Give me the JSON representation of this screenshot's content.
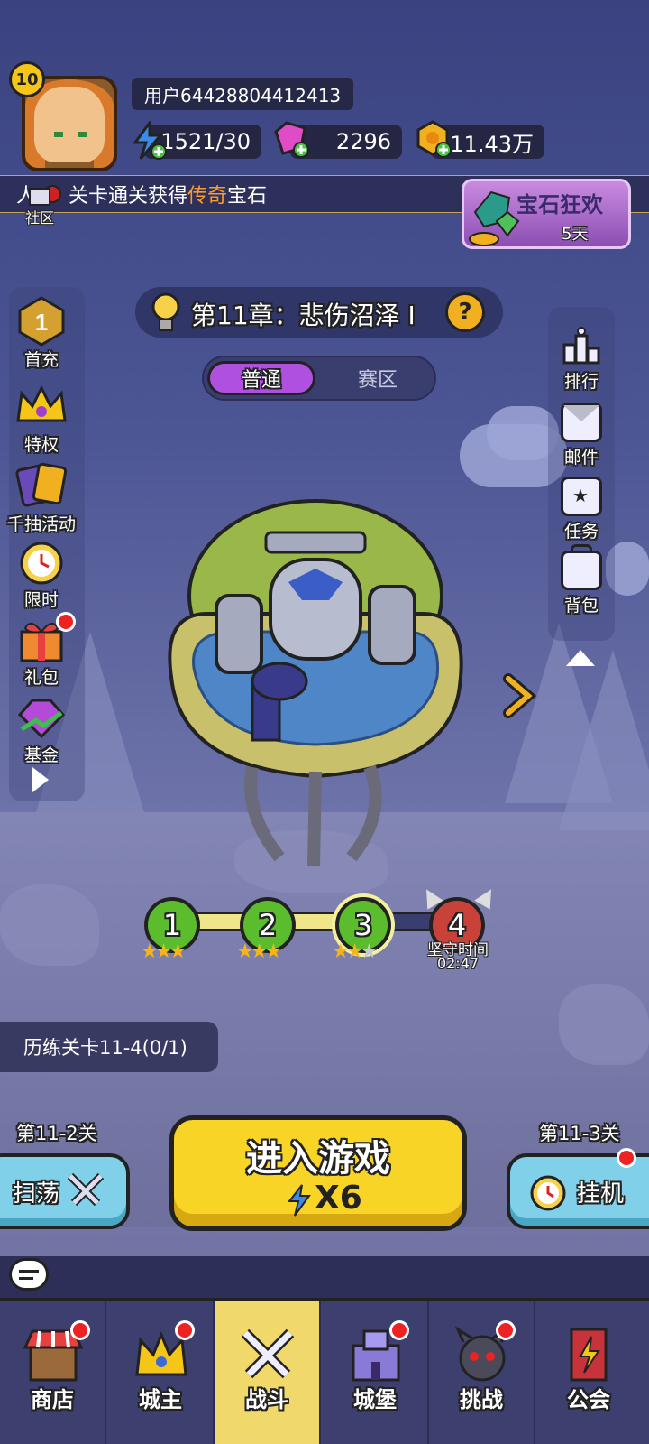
{
  "header": {
    "level": "10",
    "username": "用户64428804412413",
    "energy": "1521/30",
    "gems": "2296",
    "gold": "11.43万"
  },
  "ticker": {
    "prefix": "人",
    "text_before": "关卡通关获得",
    "highlight": "传奇",
    "text_after": "宝石"
  },
  "community_label": "社区",
  "gem_event": {
    "title": "宝石狂欢",
    "days": "5天"
  },
  "left_menu": [
    {
      "label": "首充",
      "icon": "first-charge-icon"
    },
    {
      "label": "特权",
      "icon": "crown-icon"
    },
    {
      "label": "千抽活动",
      "icon": "cards-icon"
    },
    {
      "label": "限时",
      "icon": "alarm-clock-icon"
    },
    {
      "label": "礼包",
      "icon": "gift-icon"
    },
    {
      "label": "基金",
      "icon": "gem-fund-icon"
    }
  ],
  "chapter": {
    "title": "第11章：悲伤沼泽 I"
  },
  "tabs": {
    "active": "普通",
    "inactive": "赛区"
  },
  "right_menu": [
    {
      "label": "排行",
      "icon": "ranking-icon"
    },
    {
      "label": "邮件",
      "icon": "mail-icon"
    },
    {
      "label": "任务",
      "icon": "task-icon"
    },
    {
      "label": "背包",
      "icon": "backpack-icon"
    }
  ],
  "stages": [
    {
      "num": "1",
      "stars": 3
    },
    {
      "num": "2",
      "stars": 3
    },
    {
      "num": "3",
      "stars": 2
    },
    {
      "num": "4",
      "label": "坚守时间",
      "time": "02:47"
    }
  ],
  "task": "历练关卡11-4(0/1)",
  "actions": {
    "left_level": "第11-2关",
    "sweep": "扫荡",
    "enter_title": "进入游戏",
    "enter_cost": "X6",
    "right_level": "第11-3关",
    "idle": "挂机"
  },
  "nav": [
    {
      "label": "商店",
      "badge": true
    },
    {
      "label": "城主",
      "badge": true
    },
    {
      "label": "战斗",
      "badge": false,
      "active": true
    },
    {
      "label": "城堡",
      "badge": true
    },
    {
      "label": "挑战",
      "badge": true
    },
    {
      "label": "公会",
      "badge": false
    }
  ]
}
